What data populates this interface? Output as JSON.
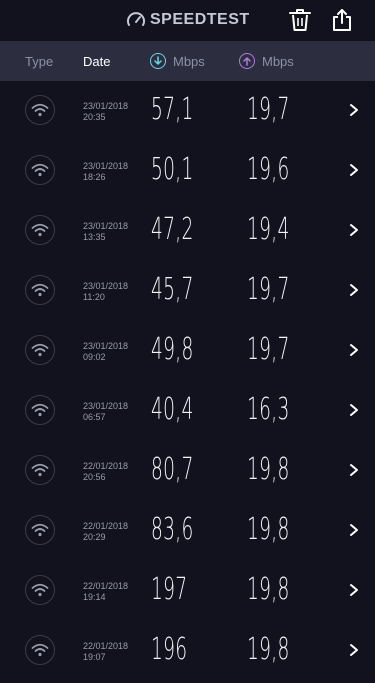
{
  "brand": {
    "name": "SPEEDTEST"
  },
  "header": {
    "type_label": "Type",
    "date_label": "Date",
    "download_label": "Mbps",
    "upload_label": "Mbps"
  },
  "colors": {
    "download_accent": "#6fd3e8",
    "upload_accent": "#b07ddc",
    "background": "#11121e",
    "header_bar": "#2c2e40"
  },
  "icons": {
    "logo": "speedometer-icon",
    "delete": "trash-icon",
    "share": "share-icon",
    "download": "arrow-down-circle-icon",
    "upload": "arrow-up-circle-icon",
    "connection": "wifi-icon",
    "row_action": "chevron-right-icon"
  },
  "results": [
    {
      "date": "23/01/2018",
      "time": "20:35",
      "download": "57,1",
      "upload": "19,7"
    },
    {
      "date": "23/01/2018",
      "time": "18:26",
      "download": "50,1",
      "upload": "19,6"
    },
    {
      "date": "23/01/2018",
      "time": "13:35",
      "download": "47,2",
      "upload": "19,4"
    },
    {
      "date": "23/01/2018",
      "time": "11:20",
      "download": "45,7",
      "upload": "19,7"
    },
    {
      "date": "23/01/2018",
      "time": "09:02",
      "download": "49,8",
      "upload": "19,7"
    },
    {
      "date": "23/01/2018",
      "time": "06:57",
      "download": "40,4",
      "upload": "16,3"
    },
    {
      "date": "22/01/2018",
      "time": "20:56",
      "download": "80,7",
      "upload": "19,8"
    },
    {
      "date": "22/01/2018",
      "time": "20:29",
      "download": "83,6",
      "upload": "19,8"
    },
    {
      "date": "22/01/2018",
      "time": "19:14",
      "download": "197",
      "upload": "19,8"
    },
    {
      "date": "22/01/2018",
      "time": "19:07",
      "download": "196",
      "upload": "19,8"
    }
  ]
}
